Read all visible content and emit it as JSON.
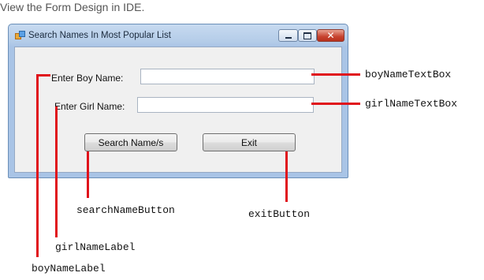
{
  "caption": "View the Form Design in IDE.",
  "window": {
    "title": "Search Names In Most Popular List",
    "icon": "form-icon"
  },
  "form": {
    "boy_label": "Enter Boy Name:",
    "girl_label": "Enter Girl Name:",
    "boy_value": "",
    "girl_value": "",
    "search_button": "Search Name/s",
    "exit_button": "Exit"
  },
  "annotations": {
    "boy_textbox": "boyNameTextBox",
    "girl_textbox": "girlNameTextBox",
    "search_button": "searchNameButton",
    "exit_button": "exitButton",
    "girl_label": "girlNameLabel",
    "boy_label": "boyNameLabel"
  },
  "colors": {
    "annotation": "#e0121b",
    "window_border": "#6b8fb8",
    "client_bg": "#f0f0f0"
  }
}
